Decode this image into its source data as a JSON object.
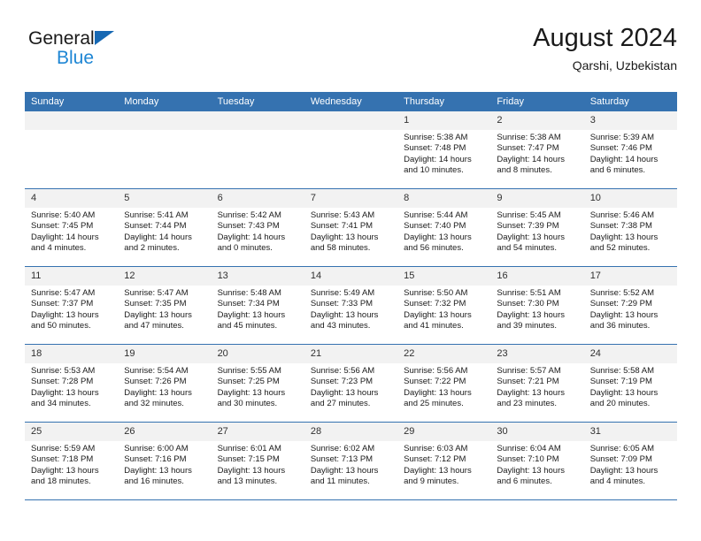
{
  "brand": {
    "name_part1": "General",
    "name_part2": "Blue",
    "triangle_color": "#1668b3",
    "blue_text_color": "#1e86d4"
  },
  "header": {
    "title": "August 2024",
    "location": "Qarshi, Uzbekistan"
  },
  "theme": {
    "header_band": "#3572b0",
    "daynum_band": "#f2f2f2",
    "grid_line": "#3572b0",
    "text": "#1a1a1a"
  },
  "weekday_headers": [
    "Sunday",
    "Monday",
    "Tuesday",
    "Wednesday",
    "Thursday",
    "Friday",
    "Saturday"
  ],
  "labels": {
    "sunrise_prefix": "Sunrise:",
    "sunset_prefix": "Sunset:",
    "daylight_prefix": "Daylight:"
  },
  "weeks": [
    [
      {
        "day": "",
        "empty": true
      },
      {
        "day": "",
        "empty": true
      },
      {
        "day": "",
        "empty": true
      },
      {
        "day": "",
        "empty": true
      },
      {
        "day": "1",
        "sunrise": "Sunrise: 5:38 AM",
        "sunset": "Sunset: 7:48 PM",
        "daylight": "Daylight: 14 hours and 10 minutes."
      },
      {
        "day": "2",
        "sunrise": "Sunrise: 5:38 AM",
        "sunset": "Sunset: 7:47 PM",
        "daylight": "Daylight: 14 hours and 8 minutes."
      },
      {
        "day": "3",
        "sunrise": "Sunrise: 5:39 AM",
        "sunset": "Sunset: 7:46 PM",
        "daylight": "Daylight: 14 hours and 6 minutes."
      }
    ],
    [
      {
        "day": "4",
        "sunrise": "Sunrise: 5:40 AM",
        "sunset": "Sunset: 7:45 PM",
        "daylight": "Daylight: 14 hours and 4 minutes."
      },
      {
        "day": "5",
        "sunrise": "Sunrise: 5:41 AM",
        "sunset": "Sunset: 7:44 PM",
        "daylight": "Daylight: 14 hours and 2 minutes."
      },
      {
        "day": "6",
        "sunrise": "Sunrise: 5:42 AM",
        "sunset": "Sunset: 7:43 PM",
        "daylight": "Daylight: 14 hours and 0 minutes."
      },
      {
        "day": "7",
        "sunrise": "Sunrise: 5:43 AM",
        "sunset": "Sunset: 7:41 PM",
        "daylight": "Daylight: 13 hours and 58 minutes."
      },
      {
        "day": "8",
        "sunrise": "Sunrise: 5:44 AM",
        "sunset": "Sunset: 7:40 PM",
        "daylight": "Daylight: 13 hours and 56 minutes."
      },
      {
        "day": "9",
        "sunrise": "Sunrise: 5:45 AM",
        "sunset": "Sunset: 7:39 PM",
        "daylight": "Daylight: 13 hours and 54 minutes."
      },
      {
        "day": "10",
        "sunrise": "Sunrise: 5:46 AM",
        "sunset": "Sunset: 7:38 PM",
        "daylight": "Daylight: 13 hours and 52 minutes."
      }
    ],
    [
      {
        "day": "11",
        "sunrise": "Sunrise: 5:47 AM",
        "sunset": "Sunset: 7:37 PM",
        "daylight": "Daylight: 13 hours and 50 minutes."
      },
      {
        "day": "12",
        "sunrise": "Sunrise: 5:47 AM",
        "sunset": "Sunset: 7:35 PM",
        "daylight": "Daylight: 13 hours and 47 minutes."
      },
      {
        "day": "13",
        "sunrise": "Sunrise: 5:48 AM",
        "sunset": "Sunset: 7:34 PM",
        "daylight": "Daylight: 13 hours and 45 minutes."
      },
      {
        "day": "14",
        "sunrise": "Sunrise: 5:49 AM",
        "sunset": "Sunset: 7:33 PM",
        "daylight": "Daylight: 13 hours and 43 minutes."
      },
      {
        "day": "15",
        "sunrise": "Sunrise: 5:50 AM",
        "sunset": "Sunset: 7:32 PM",
        "daylight": "Daylight: 13 hours and 41 minutes."
      },
      {
        "day": "16",
        "sunrise": "Sunrise: 5:51 AM",
        "sunset": "Sunset: 7:30 PM",
        "daylight": "Daylight: 13 hours and 39 minutes."
      },
      {
        "day": "17",
        "sunrise": "Sunrise: 5:52 AM",
        "sunset": "Sunset: 7:29 PM",
        "daylight": "Daylight: 13 hours and 36 minutes."
      }
    ],
    [
      {
        "day": "18",
        "sunrise": "Sunrise: 5:53 AM",
        "sunset": "Sunset: 7:28 PM",
        "daylight": "Daylight: 13 hours and 34 minutes."
      },
      {
        "day": "19",
        "sunrise": "Sunrise: 5:54 AM",
        "sunset": "Sunset: 7:26 PM",
        "daylight": "Daylight: 13 hours and 32 minutes."
      },
      {
        "day": "20",
        "sunrise": "Sunrise: 5:55 AM",
        "sunset": "Sunset: 7:25 PM",
        "daylight": "Daylight: 13 hours and 30 minutes."
      },
      {
        "day": "21",
        "sunrise": "Sunrise: 5:56 AM",
        "sunset": "Sunset: 7:23 PM",
        "daylight": "Daylight: 13 hours and 27 minutes."
      },
      {
        "day": "22",
        "sunrise": "Sunrise: 5:56 AM",
        "sunset": "Sunset: 7:22 PM",
        "daylight": "Daylight: 13 hours and 25 minutes."
      },
      {
        "day": "23",
        "sunrise": "Sunrise: 5:57 AM",
        "sunset": "Sunset: 7:21 PM",
        "daylight": "Daylight: 13 hours and 23 minutes."
      },
      {
        "day": "24",
        "sunrise": "Sunrise: 5:58 AM",
        "sunset": "Sunset: 7:19 PM",
        "daylight": "Daylight: 13 hours and 20 minutes."
      }
    ],
    [
      {
        "day": "25",
        "sunrise": "Sunrise: 5:59 AM",
        "sunset": "Sunset: 7:18 PM",
        "daylight": "Daylight: 13 hours and 18 minutes."
      },
      {
        "day": "26",
        "sunrise": "Sunrise: 6:00 AM",
        "sunset": "Sunset: 7:16 PM",
        "daylight": "Daylight: 13 hours and 16 minutes."
      },
      {
        "day": "27",
        "sunrise": "Sunrise: 6:01 AM",
        "sunset": "Sunset: 7:15 PM",
        "daylight": "Daylight: 13 hours and 13 minutes."
      },
      {
        "day": "28",
        "sunrise": "Sunrise: 6:02 AM",
        "sunset": "Sunset: 7:13 PM",
        "daylight": "Daylight: 13 hours and 11 minutes."
      },
      {
        "day": "29",
        "sunrise": "Sunrise: 6:03 AM",
        "sunset": "Sunset: 7:12 PM",
        "daylight": "Daylight: 13 hours and 9 minutes."
      },
      {
        "day": "30",
        "sunrise": "Sunrise: 6:04 AM",
        "sunset": "Sunset: 7:10 PM",
        "daylight": "Daylight: 13 hours and 6 minutes."
      },
      {
        "day": "31",
        "sunrise": "Sunrise: 6:05 AM",
        "sunset": "Sunset: 7:09 PM",
        "daylight": "Daylight: 13 hours and 4 minutes."
      }
    ]
  ]
}
